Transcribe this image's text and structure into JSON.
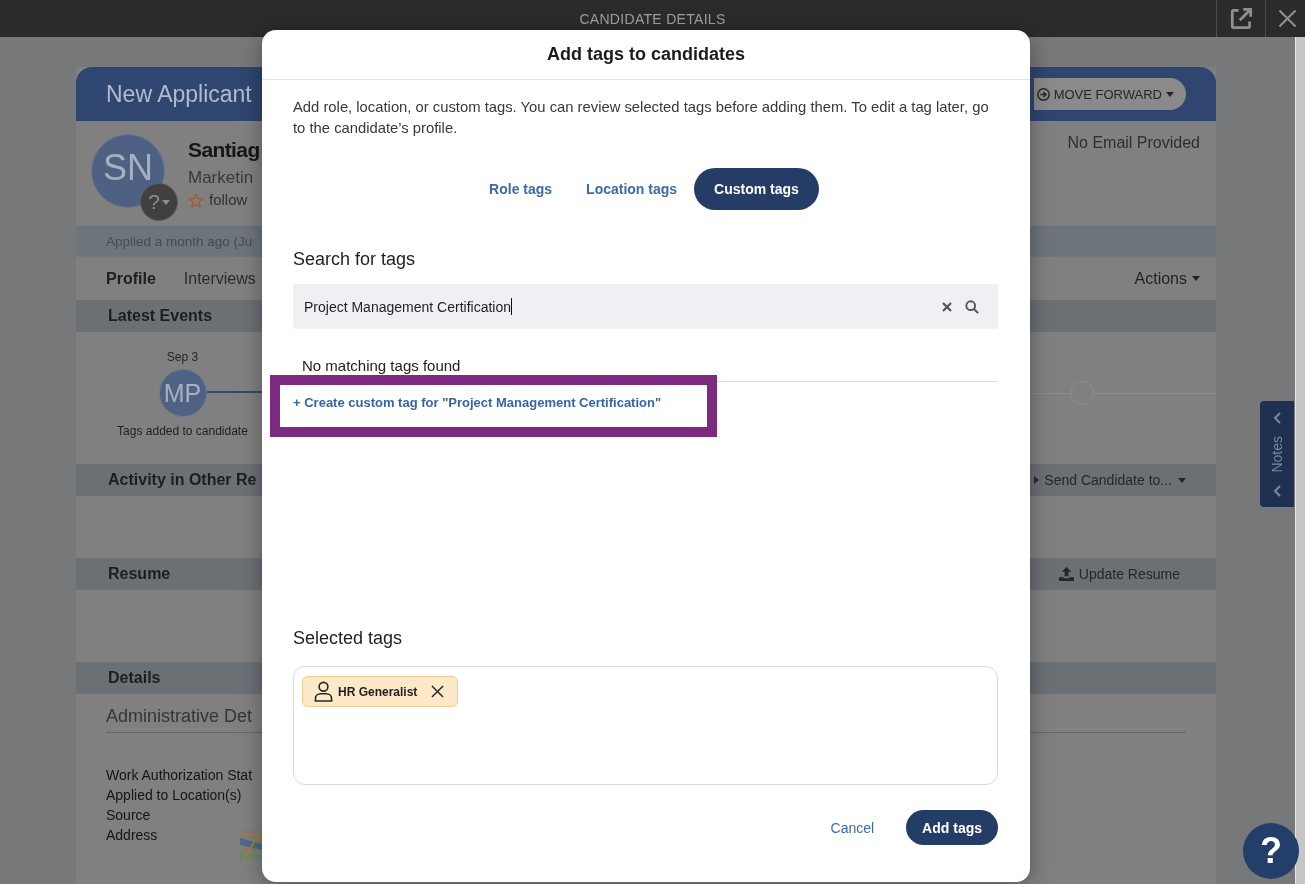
{
  "top_bar": {
    "title": "CANDIDATE DETAILS"
  },
  "candidate": {
    "banner": {
      "status": "New Applicant",
      "move_forward": "MOVE FORWARD"
    },
    "profile": {
      "initials": "SN",
      "status_badge": "?",
      "name": "Santiag",
      "role": "Marketin",
      "follow": {
        "label": "follow",
        "followed": false
      },
      "email": "No Email Provided"
    },
    "applied": "Applied a month ago (Ju",
    "tabs": [
      {
        "label": "Profile",
        "selected": true
      },
      {
        "label": "Interviews",
        "selected": false
      }
    ],
    "actions_menu": "Actions",
    "sections": [
      {
        "kind": "events",
        "title": "Latest Events",
        "events": [
          {
            "date": "Sep 3",
            "initials": "MP",
            "description": "Tags added to candidate"
          }
        ]
      },
      {
        "kind": "activity",
        "title": "Activity in Other Re",
        "action": "Send Candidate to..."
      },
      {
        "kind": "resume",
        "title": "Resume",
        "action": "Update Resume"
      },
      {
        "kind": "details",
        "title": "Details",
        "subtitle": "Administrative Det",
        "fields": [
          "Work Authorization Stat",
          "Applied to Location(s)",
          "Source",
          "Address"
        ]
      }
    ]
  },
  "notes_tab": {
    "label": "Notes"
  },
  "help_button": {
    "label": "?"
  },
  "dialog": {
    "title": "Add tags to candidates",
    "description": "Add role, location, or custom tags. You can review selected tags before adding them. To edit a tag later, go to the candidate’s profile.",
    "tag_types": [
      {
        "label": "Role tags",
        "selected": false
      },
      {
        "label": "Location tags",
        "selected": false
      },
      {
        "label": "Custom tags",
        "selected": true
      }
    ],
    "search": {
      "heading": "Search for tags",
      "value": "Project Management Certification"
    },
    "no_results": "No matching tags found",
    "create_link": {
      "label": "+ Create custom tag for \"Project Management Certification\"",
      "highlighted": true
    },
    "selected_tags": {
      "heading": "Selected tags",
      "tags": [
        {
          "kind": "role",
          "label": "HR Generalist"
        }
      ]
    },
    "cancel_button": "Cancel",
    "confirm_button": "Add tags"
  }
}
